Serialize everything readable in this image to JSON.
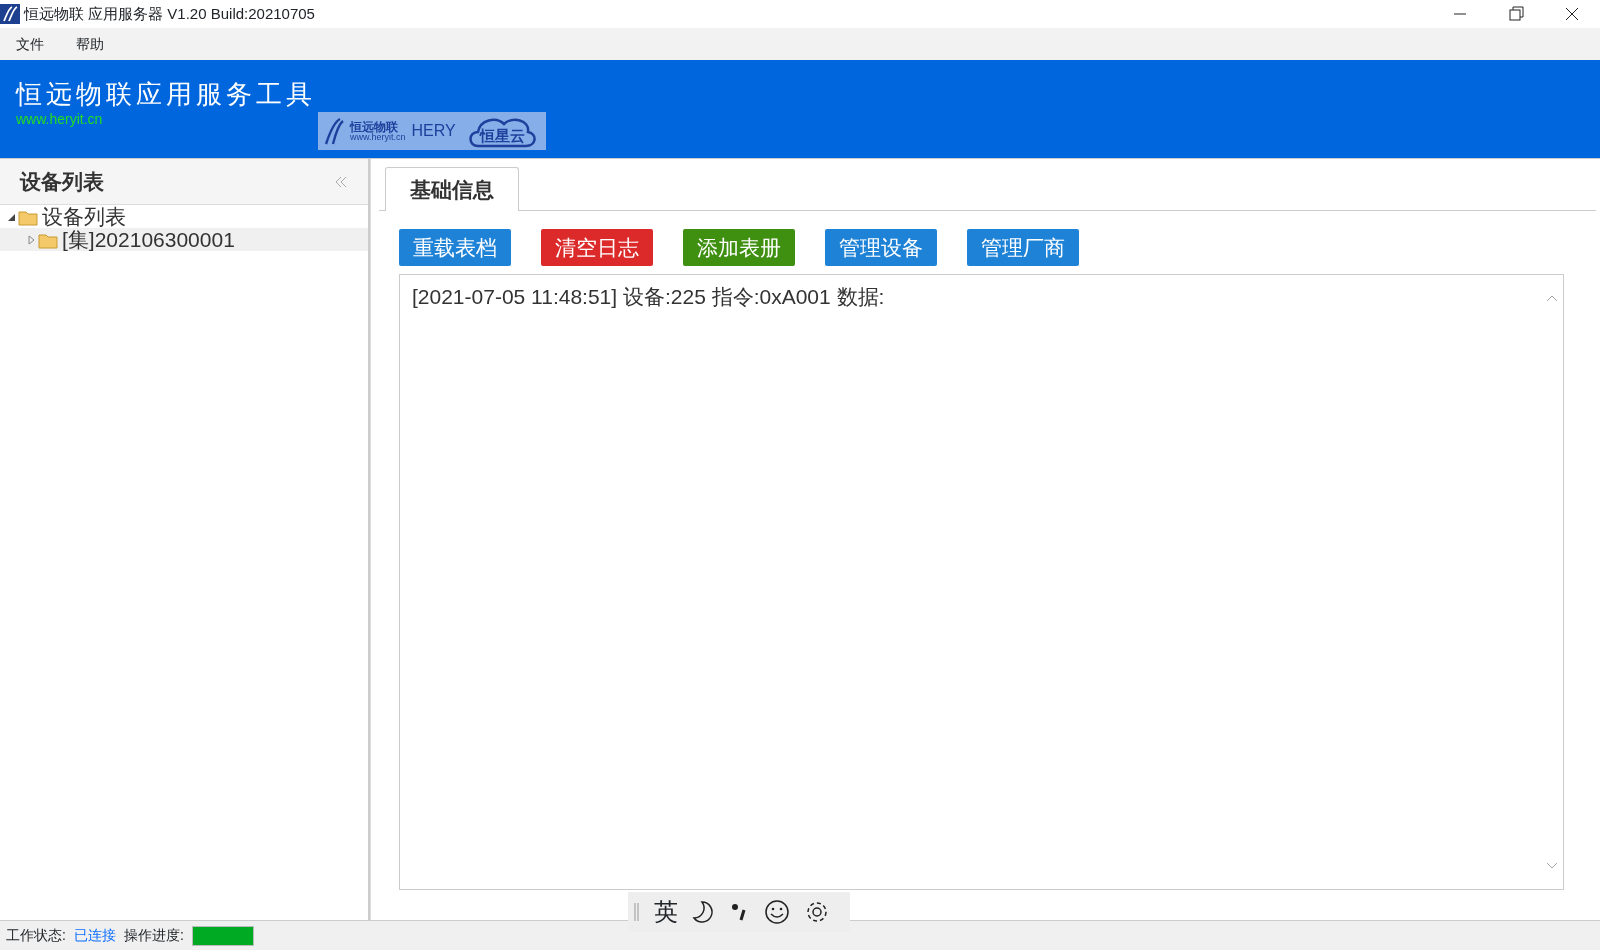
{
  "window": {
    "title": "恒远物联 应用服务器 V1.20 Build:20210705"
  },
  "menu": [
    "文件",
    "帮助"
  ],
  "header": {
    "title": "恒远物联应用服务工具",
    "url": "www.heryit.cn",
    "logo": {
      "brand": "恒远物联",
      "site": "www.heryit.cn",
      "name": "HERY",
      "cloud": "恒星云"
    }
  },
  "sidebar": {
    "title": "设备列表",
    "tree": [
      {
        "label": "设备列表",
        "expanded": true,
        "children": [
          {
            "label": "[集]202106300001",
            "expanded": false,
            "selected": true
          }
        ]
      }
    ]
  },
  "tabs": [
    {
      "label": "基础信息",
      "selected": true
    }
  ],
  "buttons": [
    {
      "label": "重载表档",
      "color": "#1e82d6"
    },
    {
      "label": "清空日志",
      "color": "#dc2a2a"
    },
    {
      "label": "添加表册",
      "color": "#3f8f10"
    },
    {
      "label": "管理设备",
      "color": "#1e82d6"
    },
    {
      "label": "管理厂商",
      "color": "#1e82d6"
    }
  ],
  "log": [
    "[2021-07-05 11:48:51] 设备:225 指令:0xA001 数据:"
  ],
  "ime_toolbar": {
    "mode": "英"
  },
  "status_bar": {
    "state_label": "工作状态:",
    "state": "已连接",
    "progress_label": "操作进度:",
    "progress": {
      "level": 1
    }
  }
}
